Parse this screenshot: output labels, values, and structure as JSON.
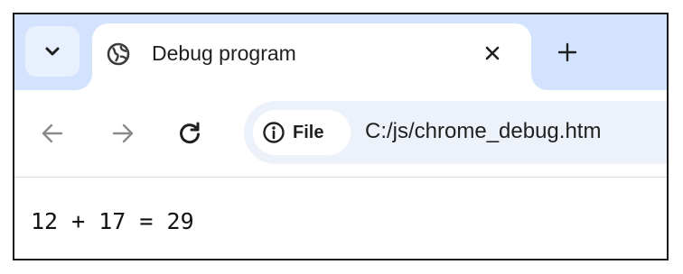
{
  "tab": {
    "title": "Debug program",
    "favicon": "globe-icon",
    "close": "close-icon"
  },
  "tabstrip": {
    "search_icon": "chevron-down-icon",
    "new_tab_icon": "plus-icon"
  },
  "toolbar": {
    "back_icon": "arrow-left-icon",
    "forward_icon": "arrow-right-icon",
    "reload_icon": "reload-icon",
    "chip_label": "File",
    "chip_icon": "info-icon",
    "url": "C:/js/chrome_debug.htm"
  },
  "page": {
    "output": "12 + 17 = 29"
  },
  "colors": {
    "tabstrip_bg": "#d3e3fd",
    "omnibox_bg": "#edf2fa",
    "text": "#1f1f1f",
    "disabled_icon": "#8a8a8a"
  }
}
